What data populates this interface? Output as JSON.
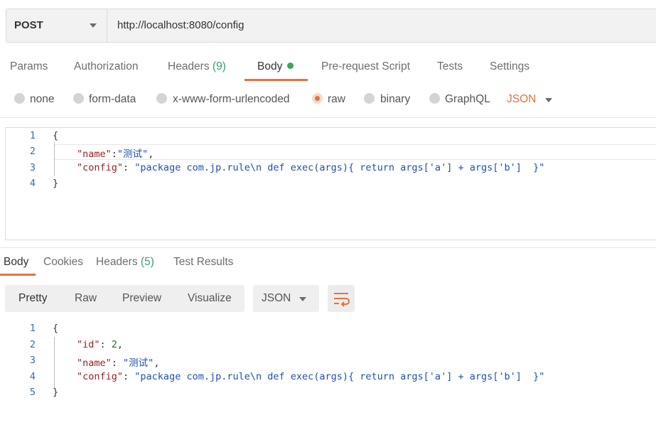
{
  "request": {
    "method": "POST",
    "url": "http://localhost:8080/config"
  },
  "request_tabs": [
    {
      "label": "Params"
    },
    {
      "label": "Authorization"
    },
    {
      "label": "Headers",
      "count": "(9)"
    },
    {
      "label": "Body"
    },
    {
      "label": "Pre-request Script"
    },
    {
      "label": "Tests"
    },
    {
      "label": "Settings"
    }
  ],
  "body_types": [
    {
      "label": "none"
    },
    {
      "label": "form-data"
    },
    {
      "label": "x-www-form-urlencoded"
    },
    {
      "label": "raw"
    },
    {
      "label": "binary"
    },
    {
      "label": "GraphQL"
    }
  ],
  "raw_format": "JSON",
  "request_body": {
    "line_numbers": [
      "1",
      "2",
      "3",
      "4"
    ],
    "open_brace": "{",
    "close_brace": "}",
    "key_name": "\"name\"",
    "val_name": "\"测试\"",
    "key_config": "\"config\"",
    "val_config": "\"package com.jp.rule\\n def exec(args){ return args['a'] + args['b']  }\""
  },
  "response_tabs": [
    {
      "label": "Body"
    },
    {
      "label": "Cookies"
    },
    {
      "label": "Headers",
      "count": "(5)"
    },
    {
      "label": "Test Results"
    }
  ],
  "view_modes": [
    {
      "label": "Pretty"
    },
    {
      "label": "Raw"
    },
    {
      "label": "Preview"
    },
    {
      "label": "Visualize"
    }
  ],
  "response_format": "JSON",
  "response_body": {
    "line_numbers": [
      "1",
      "2",
      "3",
      "4",
      "5"
    ],
    "open_brace": "{",
    "close_brace": "}",
    "key_id": "\"id\"",
    "val_id": "2",
    "key_name": "\"name\"",
    "val_name": "\"测试\"",
    "key_config": "\"config\"",
    "val_config": "\"package com.jp.rule\\n def exec(args){ return args['a'] + args['b']  }\""
  },
  "colors": {
    "accent": "#e8703e",
    "count_green": "#38a169",
    "body_dot": "#3aa55d"
  },
  "icons": {
    "method_dropdown": "chevron-down-icon",
    "wrap": "wrap-lines-icon"
  }
}
